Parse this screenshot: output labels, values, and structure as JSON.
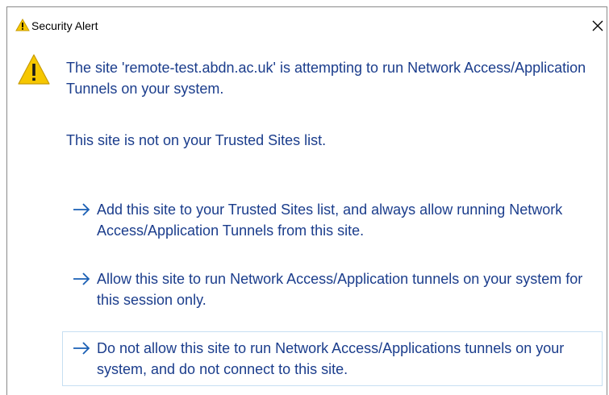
{
  "window": {
    "title": "Security Alert",
    "close_label": "×"
  },
  "message": {
    "line1": "The site 'remote-test.abdn.ac.uk' is attempting to run Network Access/Application Tunnels on your system.",
    "untrusted": "This site is not on your Trusted Sites list."
  },
  "options": [
    {
      "label": "Add this site to your Trusted Sites list, and always allow running Network Access/Application Tunnels from this site.",
      "icon": "arrow-right-icon"
    },
    {
      "label": "Allow this site to run Network Access/Application tunnels on your system for this session only.",
      "icon": "arrow-right-icon"
    },
    {
      "label": "Do not allow this site to run Network Access/Applications tunnels on your system, and do not connect to this site.",
      "icon": "arrow-right-icon"
    }
  ],
  "colors": {
    "text": "#1b3d8c",
    "arrow": "#1a5fb4",
    "warning": "#f6c700",
    "focus_border": "#c7dff2"
  }
}
